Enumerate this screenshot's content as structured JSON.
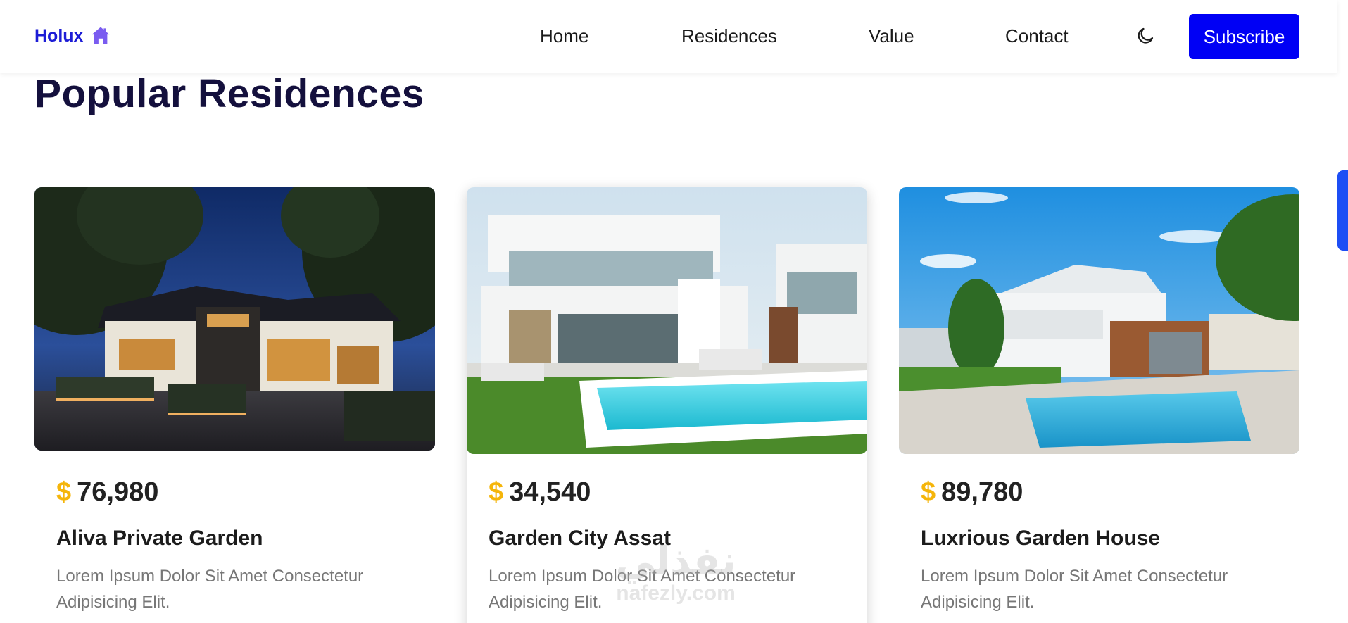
{
  "brand": {
    "name": "Holux",
    "icon": "house-icon",
    "color": "#1d1dd6"
  },
  "nav": {
    "items": [
      {
        "label": "Home"
      },
      {
        "label": "Residences"
      },
      {
        "label": "Value"
      },
      {
        "label": "Contact"
      }
    ],
    "theme_toggle_icon": "moon-icon",
    "subscribe_label": "Subscribe",
    "accent": "#0000f5"
  },
  "section": {
    "title": "Popular Residences"
  },
  "residences": [
    {
      "currency": "$",
      "price": "76,980",
      "name": "Aliva Private Garden",
      "description": "Lorem Ipsum Dolor Sit Amet Consectetur Adipisicing Elit."
    },
    {
      "currency": "$",
      "price": "34,540",
      "name": "Garden City Assat",
      "description": "Lorem Ipsum Dolor Sit Amet Consectetur Adipisicing Elit."
    },
    {
      "currency": "$",
      "price": "89,780",
      "name": "Luxrious Garden House",
      "description": "Lorem Ipsum Dolor Sit Amet Consectetur Adipisicing Elit."
    }
  ],
  "watermark": {
    "arabic": "نفذلي",
    "latin": "nafezly.com"
  },
  "colors": {
    "price_symbol": "#f5b50a",
    "title": "#14103d",
    "scrollbar": "#1d4ef5"
  }
}
